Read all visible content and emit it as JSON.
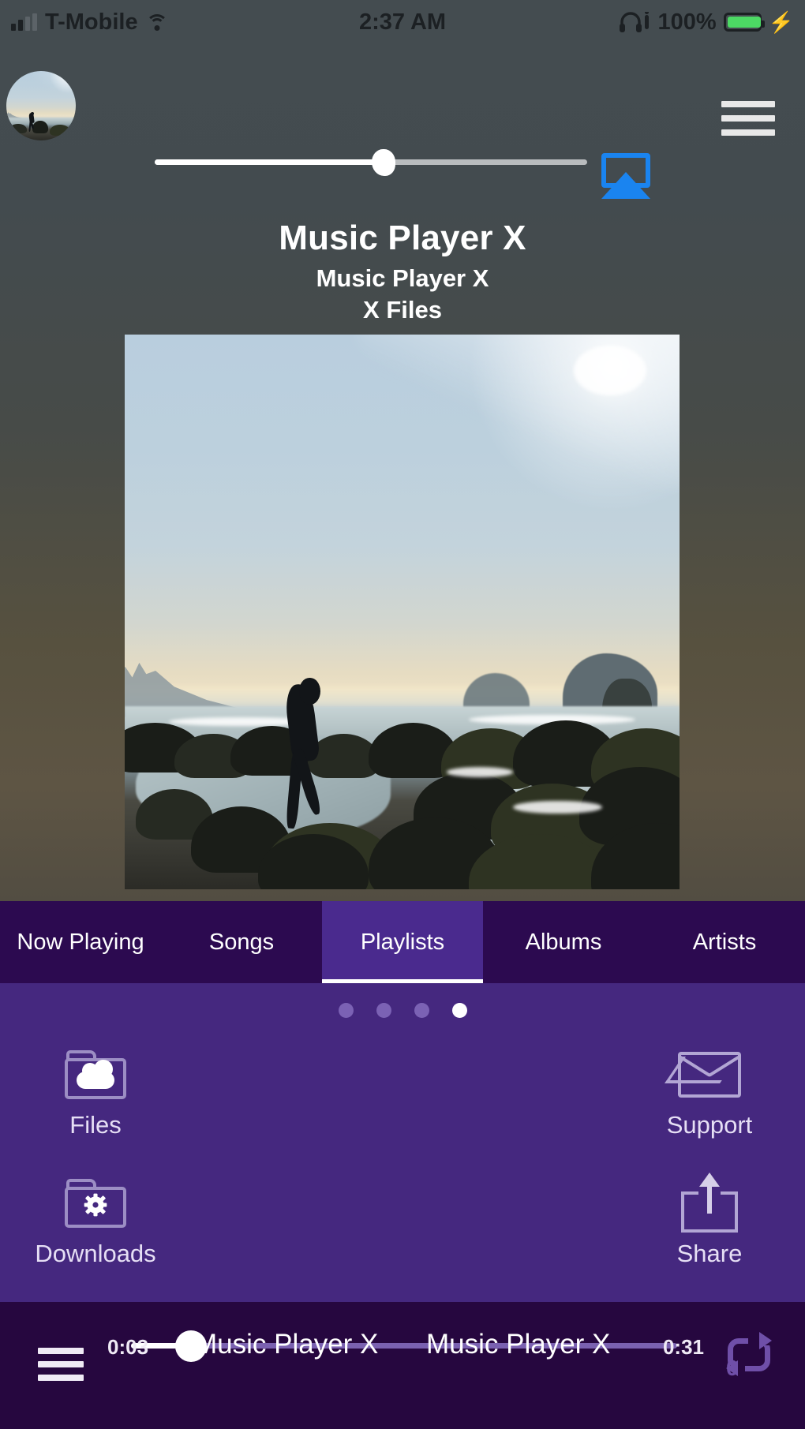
{
  "status_bar": {
    "carrier": "T-Mobile",
    "time": "2:37 AM",
    "battery_percent": "100%",
    "battery_level": 100,
    "signal_icon": "signal-bars-icon",
    "wifi_icon": "wifi-icon",
    "headphones_icon": "headphones-icon",
    "charging_icon": "lightning-bolt-icon"
  },
  "header": {
    "avatar_icon": "avatar-artwork",
    "menu_icon": "hamburger-menu-icon",
    "airplay_icon": "airplay-icon",
    "volume_value": 53
  },
  "track": {
    "title": "Music Player X",
    "artist": "Music Player X",
    "album": "X Files"
  },
  "artwork": {
    "description": "beach-artwork"
  },
  "tabs": [
    {
      "label": "Now Playing",
      "active": false
    },
    {
      "label": "Songs",
      "active": false
    },
    {
      "label": "Playlists",
      "active": true
    },
    {
      "label": "Albums",
      "active": false
    },
    {
      "label": "Artists",
      "active": false
    }
  ],
  "pager": {
    "total": 4,
    "active_index": 3
  },
  "shortcuts": [
    {
      "label": "Files",
      "icon": "folder-cloud-icon"
    },
    {
      "label": "Support",
      "icon": "envelope-icon"
    },
    {
      "label": "Downloads",
      "icon": "folder-gear-icon"
    },
    {
      "label": "Share",
      "icon": "share-icon"
    }
  ],
  "player": {
    "menu_icon": "hamburger-menu-icon",
    "elapsed": "0:03",
    "duration": "0:31",
    "title": "Music Player X",
    "artist": "Music Player X",
    "progress_percent": 11,
    "repeat_icon": "repeat-icon",
    "repeat_count": "0"
  },
  "colors": {
    "tabbar_bg": "#2c0a50",
    "tab_active_bg": "#4a2a8e",
    "panel_bg": "#45287f",
    "player_bg": "#26073f",
    "airplay_blue": "#1a84f0",
    "battery_green": "#4cd964",
    "repeat_purple": "#6f4fa8"
  }
}
